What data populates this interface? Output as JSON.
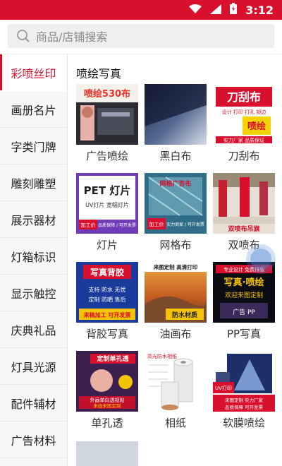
{
  "status": {
    "time": "3:12"
  },
  "search": {
    "placeholder": "商品/店铺搜索"
  },
  "sidebar": {
    "items": [
      {
        "label": "彩喷丝印",
        "active": true
      },
      {
        "label": "画册名片"
      },
      {
        "label": "字类门牌"
      },
      {
        "label": "雕刻雕塑"
      },
      {
        "label": "展示器材"
      },
      {
        "label": "灯箱标识"
      },
      {
        "label": "显示触控"
      },
      {
        "label": "庆典礼品"
      },
      {
        "label": "灯具光源"
      },
      {
        "label": "配件辅材"
      },
      {
        "label": "广告材料"
      }
    ]
  },
  "main": {
    "section_title": "喷绘写真",
    "products": [
      {
        "label": "广告喷绘",
        "thumb_text": [
          "喷绘530布"
        ]
      },
      {
        "label": "黑白布",
        "thumb_text": []
      },
      {
        "label": "刀刮布",
        "thumb_text": [
          "刀刮布",
          "设计 打印 打孔 锁边",
          "喷绘",
          "实力厂家 品质保证"
        ]
      },
      {
        "label": "灯片",
        "thumb_text": [
          "PET 灯片",
          "UV灯片  宽幅灯片",
          "加工价",
          "品质保障 / 可开发票"
        ]
      },
      {
        "label": "网格布",
        "thumb_text": [
          "网格广告布",
          "加工价",
          "实力商家 / 可开发票"
        ]
      },
      {
        "label": "双喷布",
        "thumb_text": [
          "双喷布吊旗"
        ]
      },
      {
        "label": "背胶写真",
        "thumb_text": [
          "写真背胶",
          "支持 防水 无忧",
          "定制 防晒 售后",
          "来稿加工 可开发票"
        ]
      },
      {
        "label": "油画布",
        "thumb_text": [
          "来图定制 高清打印",
          "防水材质"
        ]
      },
      {
        "label": "PP写真",
        "thumb_text": [
          "专业设计 免费排版",
          "写真·喷绘",
          "欢迎来图定制",
          "广告 PP"
        ]
      },
      {
        "label": "单孔透",
        "thumb_text": [
          "定制单孔透",
          "外画单向透视贴",
          "来画来图定制"
        ]
      },
      {
        "label": "相纸",
        "thumb_text": [
          "高光防水相纸"
        ]
      },
      {
        "label": "软膜喷绘",
        "thumb_text": [
          "UV打印",
          "来图定制 实力厂家",
          "品质保障 可开发票"
        ]
      }
    ]
  },
  "colors": {
    "brand": "#d8102e",
    "active_text": "#d8102e"
  }
}
